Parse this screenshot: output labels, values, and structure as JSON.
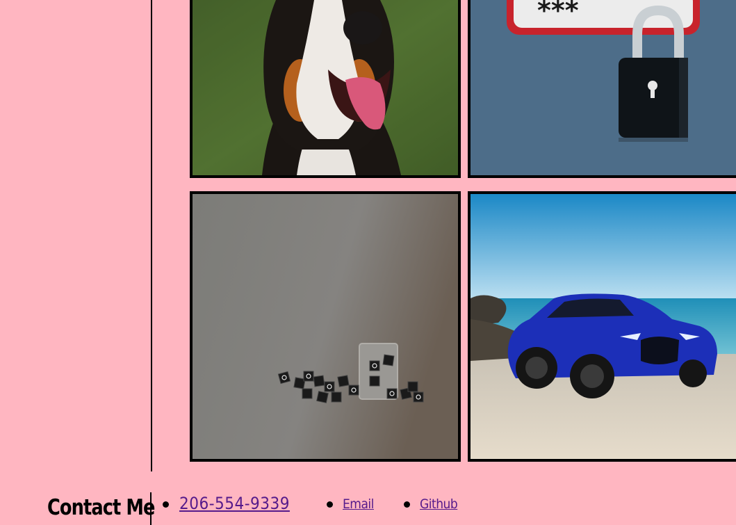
{
  "portfolio": {
    "cards": [
      {
        "name": "dog-project",
        "image": "dog-photo"
      },
      {
        "name": "password-project",
        "image": "password-lock-illustration"
      },
      {
        "name": "tictactoe-project",
        "image": "tic-tac-toe-dice-photo"
      },
      {
        "name": "car-project",
        "image": "blue-car-beach-photo"
      }
    ]
  },
  "contact": {
    "title": "Contact Me",
    "phone": "206-554-9339",
    "email_label": "Email",
    "github_label": "Github"
  },
  "colors": {
    "background": "#ffb6c1",
    "link": "#551a8b",
    "border": "#000000"
  }
}
